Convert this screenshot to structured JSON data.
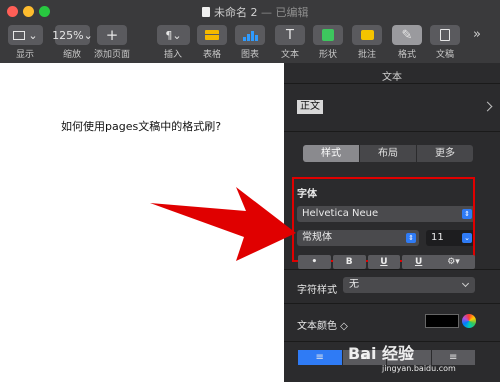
{
  "window": {
    "title": "未命名 2",
    "edited_status": "— 已编辑"
  },
  "toolbar": {
    "view_label": "显示",
    "zoom_value": "125%",
    "zoom_label": "缩放",
    "add_page_label": "添加页面",
    "insert_label": "插入",
    "table_label": "表格",
    "chart_label": "图表",
    "text_label": "文本",
    "shape_label": "形状",
    "comment_label": "批注",
    "format_label": "格式",
    "document_label": "文稿",
    "more_glyph": "»"
  },
  "document": {
    "body_text": "如何使用pages文稿中的格式刷?"
  },
  "inspector": {
    "title": "文本",
    "paragraph_style": "正文",
    "tabs": [
      "样式",
      "布局",
      "更多"
    ],
    "font_section_title": "字体",
    "font_family": "Helvetica Neue",
    "typeface": "常规体",
    "font_size": "11",
    "format_buttons": [
      "•",
      "B",
      "U",
      "U"
    ],
    "gear_glyph": "⚙▾",
    "character_style_label": "字符样式",
    "character_style_value": "无",
    "text_color_label": "文本颜色 ◇",
    "alignment_buttons": [
      "≡",
      "≡",
      "≡",
      "≡"
    ]
  },
  "colors": {
    "toolbar_bg": "#3a3a3c",
    "inspector_bg": "#2b2b2d",
    "annotation_red": "#e00000",
    "accent_blue": "#2f7bf5"
  },
  "watermark": {
    "brand": "Bai  经验",
    "url": "jingyan.baidu.com"
  }
}
